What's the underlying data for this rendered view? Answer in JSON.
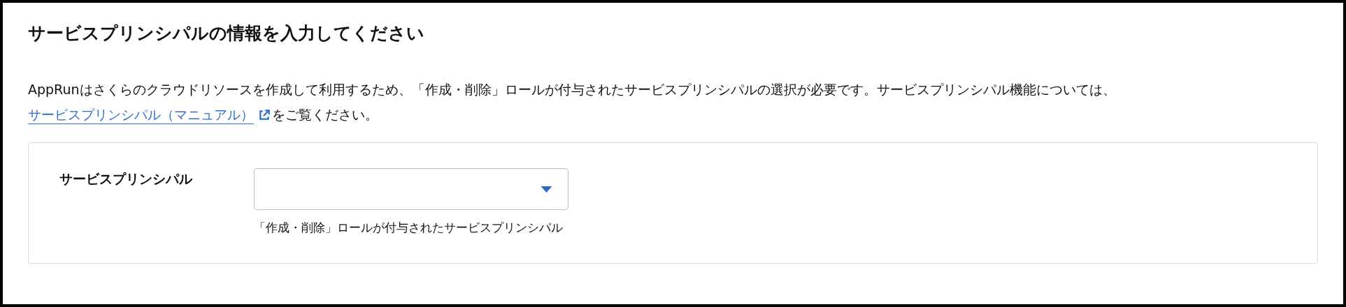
{
  "title": "サービスプリンシパルの情報を入力してください",
  "description": {
    "text_before": "AppRunはさくらのクラウドリソースを作成して利用するため、「作成・削除」ロールが付与されたサービスプリンシパルの選択が必要です。サービスプリンシパル機能については、",
    "link": "サービスプリンシパル（マニュアル）",
    "text_after": "をご覧ください。"
  },
  "form": {
    "fields": [
      {
        "kind": "select",
        "label": "サービスプリンシパル",
        "help": "「作成・削除」ロールが付与されたサービスプリンシパル"
      }
    ]
  }
}
